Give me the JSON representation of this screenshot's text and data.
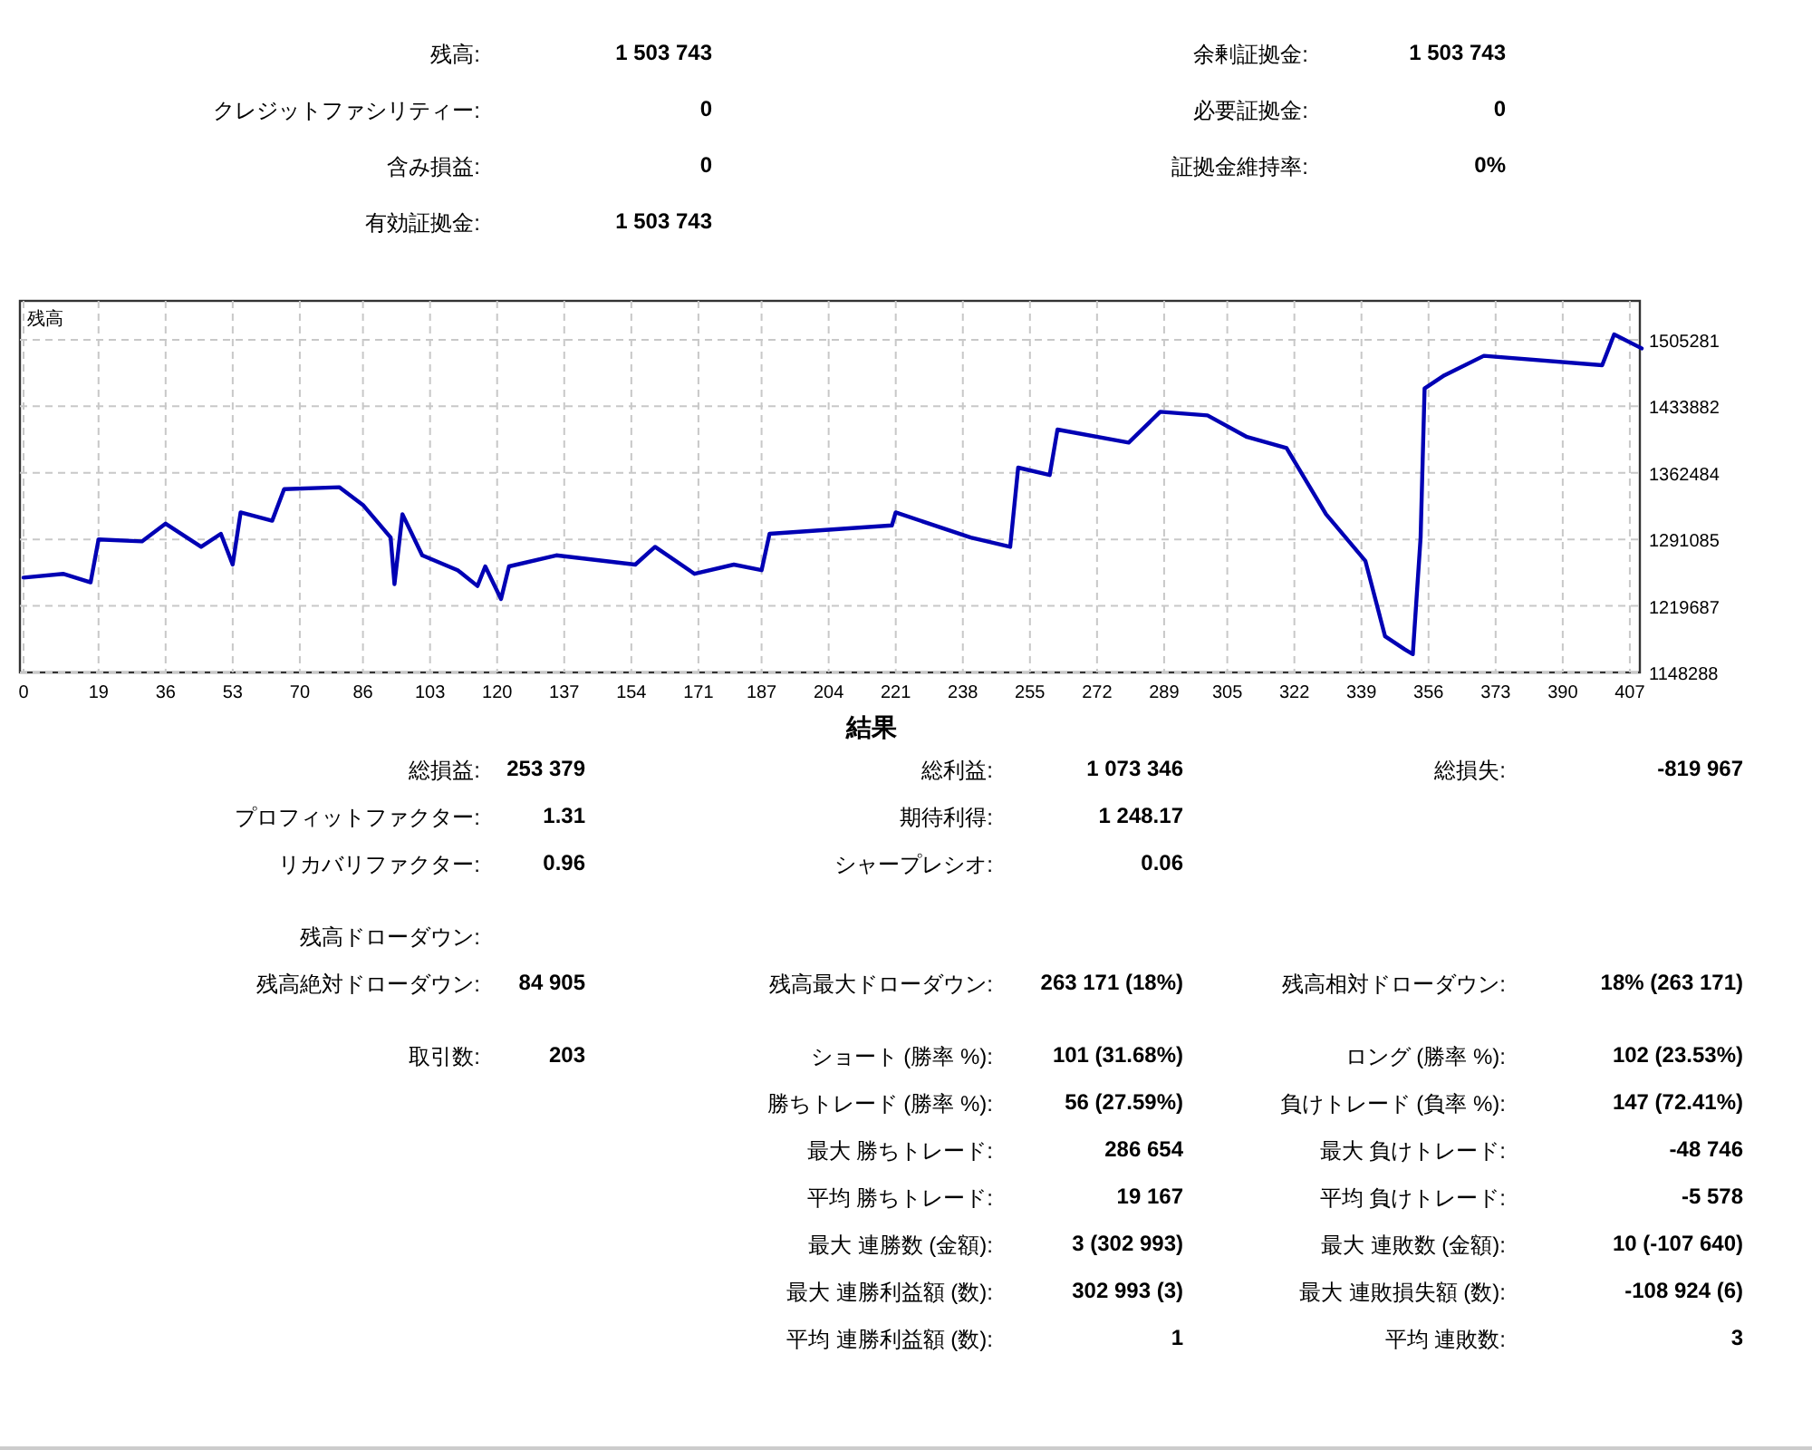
{
  "summary": {
    "rows": [
      {
        "column_1": {
          "label": "残高:",
          "value": "1 503 743"
        },
        "column_2": {
          "label": "余剰証拠金:",
          "value": "1 503 743"
        }
      },
      {
        "column_1": {
          "label": "クレジットファシリティー:",
          "value": "0"
        },
        "column_2": {
          "label": "必要証拠金:",
          "value": "0"
        }
      },
      {
        "column_1": {
          "label": "含み損益:",
          "value": "0"
        },
        "column_2": {
          "label": "証拠金維持率:",
          "value": "0%"
        }
      },
      {
        "column_1": {
          "label": "有効証拠金:",
          "value": "1 503 743"
        }
      }
    ]
  },
  "chart": {
    "chart_data": {
      "type": "line",
      "grid": true,
      "xlim": [
        0,
        410
      ],
      "ylim": [
        1148288,
        1547000
      ],
      "xticks": [
        0,
        19,
        36,
        53,
        70,
        86,
        103,
        120,
        137,
        154,
        171,
        187,
        204,
        221,
        238,
        255,
        272,
        289,
        305,
        322,
        339,
        356,
        373,
        390,
        407
      ],
      "yticks": [
        1148288,
        1219687,
        1291085,
        1362484,
        1433882,
        1505281
      ],
      "series": [
        {
          "name": "残高",
          "color": "#0000b4",
          "x": [
            0,
            10,
            17,
            19,
            30,
            36,
            45,
            50,
            53,
            55,
            63,
            66,
            80,
            86,
            93,
            94,
            96,
            101,
            110,
            115,
            117,
            121,
            123,
            135,
            155,
            160,
            170,
            180,
            187,
            189,
            220,
            221,
            240,
            250,
            252,
            260,
            262,
            280,
            288,
            300,
            310,
            320,
            330,
            340,
            345,
            350,
            352,
            354,
            355,
            360,
            370,
            400,
            403,
            410
          ],
          "values": [
            1250000,
            1254000,
            1245000,
            1291000,
            1289000,
            1308000,
            1283000,
            1297000,
            1264000,
            1320000,
            1311000,
            1345000,
            1347000,
            1328000,
            1293000,
            1243000,
            1318000,
            1274000,
            1258000,
            1241000,
            1262000,
            1227000,
            1262000,
            1274000,
            1264000,
            1283000,
            1254000,
            1264000,
            1258000,
            1297000,
            1306000,
            1320000,
            1293000,
            1283000,
            1368000,
            1360000,
            1409000,
            1395000,
            1428000,
            1424000,
            1401000,
            1389000,
            1318000,
            1268000,
            1187000,
            1173000,
            1168000,
            1293000,
            1453000,
            1467000,
            1488000,
            1478000,
            1511000,
            1496000
          ]
        }
      ]
    }
  },
  "result": {
    "title": "結果",
    "sections": [
      [
        {
          "column_1": {
            "label": "総損益:",
            "value": "253 379"
          },
          "column_2": {
            "label": "総利益:",
            "value": "1 073 346"
          },
          "column_3": {
            "label": "総損失:",
            "value": "-819 967"
          }
        },
        {
          "column_1": {
            "label": "プロフィットファクター:",
            "value": "1.31"
          },
          "column_2": {
            "label": "期待利得:",
            "value": "1 248.17"
          }
        },
        {
          "column_1": {
            "label": "リカバリファクター:",
            "value": "0.96"
          },
          "column_2": {
            "label": "シャープレシオ:",
            "value": "0.06"
          }
        }
      ],
      [
        {
          "column_1": {
            "label": "残高ドローダウン:"
          }
        },
        {
          "column_1": {
            "label": "残高絶対ドローダウン:",
            "value": "84 905"
          },
          "column_2": {
            "label": "残高最大ドローダウン:",
            "value": "263 171 (18%)"
          },
          "column_3": {
            "label": "残高相対ドローダウン:",
            "value": "18% (263 171)"
          }
        }
      ],
      [
        {
          "column_1": {
            "label": "取引数:",
            "value": "203"
          },
          "column_2": {
            "label": "ショート (勝率 %):",
            "value": "101 (31.68%)"
          },
          "column_3": {
            "label": "ロング (勝率 %):",
            "value": "102 (23.53%)"
          }
        },
        {
          "column_2": {
            "label": "勝ちトレード (勝率 %):",
            "value": "56 (27.59%)"
          },
          "column_3": {
            "label": "負けトレード (負率 %):",
            "value": "147 (72.41%)"
          }
        },
        {
          "column_2": {
            "label": "最大 勝ちトレード:",
            "value": "286 654"
          },
          "column_3": {
            "label": "最大 負けトレード:",
            "value": "-48 746"
          }
        },
        {
          "column_2": {
            "label": "平均 勝ちトレード:",
            "value": "19 167"
          },
          "column_3": {
            "label": "平均 負けトレード:",
            "value": "-5 578"
          }
        },
        {
          "column_2": {
            "label": "最大 連勝数 (金額):",
            "value": "3 (302 993)"
          },
          "column_3": {
            "label": "最大 連敗数 (金額):",
            "value": "10 (-107 640)"
          }
        },
        {
          "column_2": {
            "label": "最大 連勝利益額 (数):",
            "value": "302 993 (3)"
          },
          "column_3": {
            "label": "最大 連敗損失額 (数):",
            "value": "-108 924 (6)"
          }
        },
        {
          "column_2": {
            "label": "平均 連勝利益額 (数):",
            "value": "1"
          },
          "column_3": {
            "label": "平均 連敗数:",
            "value": "3"
          }
        }
      ]
    ]
  }
}
